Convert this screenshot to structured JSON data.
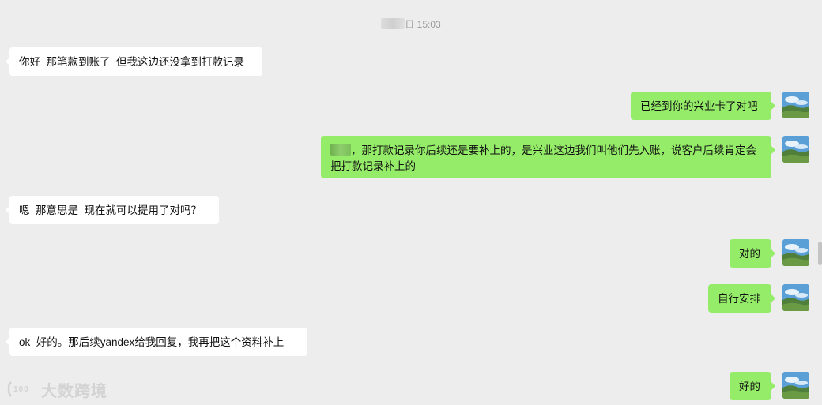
{
  "timestamp": {
    "time": "15:03",
    "suffix": "日"
  },
  "messages": [
    {
      "side": "left",
      "text": "你好  那笔款到账了  但我这边还没拿到打款记录"
    },
    {
      "side": "right",
      "text": "已经到你的兴业卡了对吧"
    },
    {
      "side": "right",
      "text": "，那打款记录你后续还是要补上的，是兴业这边我们叫他们先入账，说客户后续肯定会把打款记录补上的"
    },
    {
      "side": "left",
      "text": "嗯  那意思是  现在就可以提用了对吗？"
    },
    {
      "side": "right",
      "text": "对的"
    },
    {
      "side": "right",
      "text": "自行安排"
    },
    {
      "side": "left",
      "text": "ok  好的。那后续yandex给我回复，我再把这个资料补上"
    },
    {
      "side": "right",
      "text": "好的"
    }
  ],
  "watermark": {
    "text": "大数跨境",
    "logo_text": "100"
  },
  "colors": {
    "background": "#ededed",
    "own_bubble": "#95ec69",
    "other_bubble": "#ffffff"
  },
  "icons": {
    "avatar": "landscape-avatar-icon",
    "logo": "watermark-logo-icon"
  }
}
